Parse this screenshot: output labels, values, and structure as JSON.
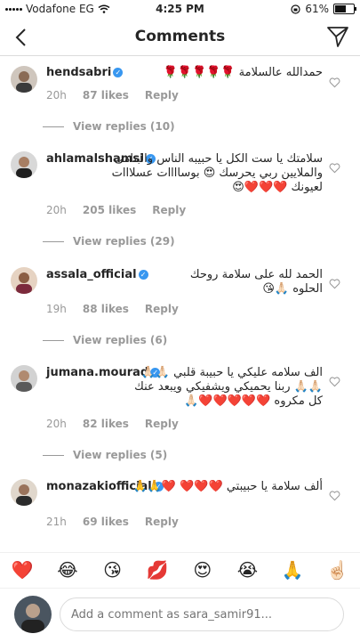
{
  "status_bar": {
    "carrier": "Vodafone EG",
    "time": "4:25 PM",
    "battery_percent": "61%",
    "battery_fraction": 0.61
  },
  "nav": {
    "title": "Comments"
  },
  "comments": [
    {
      "username": "hendsabri",
      "text": "حمدالله عالسلامة 🌹🌹🌹🌹🌹",
      "age": "20h",
      "likes": "87 likes",
      "reply": "Reply",
      "view_replies": "View replies (10)"
    },
    {
      "username": "ahlamalshamsi",
      "text": "سلامتك يا ست الكل يا حبيبه الناس  والبتامى والملايين ربي يحرسك 😍 بوساااات عسلااات لعيونك ❤️❤️❤️😍",
      "age": "20h",
      "likes": "205 likes",
      "reply": "Reply",
      "view_replies": "View replies (29)"
    },
    {
      "username": "assala_official",
      "text": "الحمد لله على سلامة روحك الحلوه 🙏🏻😘",
      "age": "19h",
      "likes": "88 likes",
      "reply": "Reply",
      "view_replies": "View replies (6)"
    },
    {
      "username": "jumana.mourad",
      "text": "الف سلامه عليكي يا حبيبة قلبي 🙏🏻🙏🏻🙏🏻🙏🏻 ربنا يحميكي ويشفيكي ويبعد عنك كل مكروه ❤️❤️❤️❤️❤️🙏🏻",
      "age": "20h",
      "likes": "82 likes",
      "reply": "Reply",
      "view_replies": "View replies (5)"
    },
    {
      "username": "monazakiofficial",
      "text": "ألف سلامة يا حبيبتي ❤️❤️❤️ ❤️🙏🙏",
      "age": "21h",
      "likes": "69 likes",
      "reply": "Reply"
    }
  ],
  "emoji_bar": [
    "❤️",
    "😂",
    "😘",
    "💋",
    "😍",
    "😭",
    "🙏",
    "☝🏻"
  ],
  "composer": {
    "placeholder": "Add a comment as sara_samir91..."
  },
  "colors": {
    "verified": "#3897f0",
    "meta_gray": "#999999",
    "heart": "#ed4956"
  }
}
